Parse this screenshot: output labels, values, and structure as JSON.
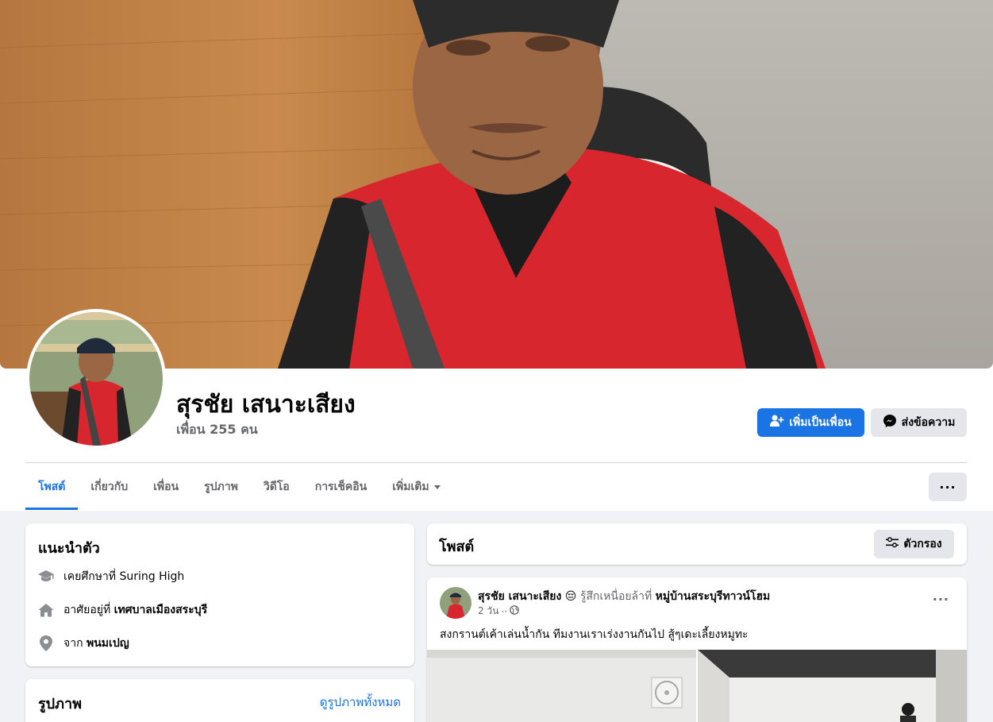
{
  "profile": {
    "name": "สุรชัย เสนาะเสียง",
    "friends": "เพื่อน 255 คน"
  },
  "actions": {
    "add_friend": "เพิ่มเป็นเพื่อน",
    "message": "ส่งข้อความ"
  },
  "tabs": [
    {
      "label": "โพสต์",
      "active": true
    },
    {
      "label": "เกี่ยวกับ"
    },
    {
      "label": "เพื่อน"
    },
    {
      "label": "รูปภาพ"
    },
    {
      "label": "วิดีโอ"
    },
    {
      "label": "การเช็คอิน"
    },
    {
      "label": "เพิ่มเติม"
    }
  ],
  "more_menu": "···",
  "intro": {
    "title": "แนะนำตัว",
    "education": {
      "prefix": "เคยศึกษาที่",
      "value": "Suring High"
    },
    "lives": {
      "prefix": "อาศัยอยู่ที่",
      "value": "เทศบาลเมืองสระบุรี"
    },
    "from": {
      "prefix": "จาก",
      "value": "พนมเปญ"
    }
  },
  "photos": {
    "title": "รูปภาพ",
    "see_all": "ดูรูปภาพทั้งหมด"
  },
  "posts": {
    "title": "โพสต์",
    "filter": "ตัวกรอง"
  },
  "post": {
    "author": "สุรชัย เสนาะเสียง",
    "emoji": "😔",
    "feeling": "รู้สึกเหนื่อยล้าที่",
    "place": "หมู่บ้านสระบุรีทาวน์โฮม",
    "time": "2 วัน",
    "dot": "··",
    "more": "···",
    "text": "สงกรานต์เค้าเล่นน้ำกัน  ทีมงานเราเร่งงานกันไป   สู้ๆเดะเลี้ยงหมูทะ"
  },
  "colors": {
    "accent": "#1b74e4",
    "background": "#f0f2f5",
    "secondary_button": "#e4e6eb"
  }
}
